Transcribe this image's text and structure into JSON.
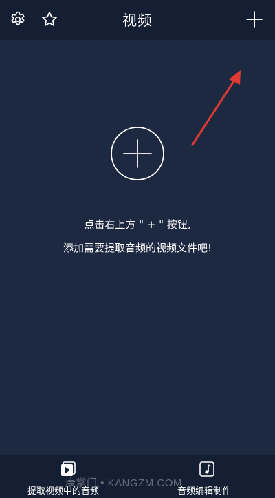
{
  "header": {
    "title": "视频",
    "settings_icon": "gear-icon",
    "favorites_icon": "star-icon",
    "add_icon": "plus-icon"
  },
  "main": {
    "add_icon": "circle-plus-icon",
    "hint_line1": "点击右上方 \" + \" 按钮,",
    "hint_line2": "添加需要提取音频的视频文件吧!",
    "annotation_color": "#e03b32"
  },
  "tabbar": {
    "tabs": [
      {
        "label": "提取视频中的音频",
        "icon": "video-play-icon"
      },
      {
        "label": "音频编辑制作",
        "icon": "music-note-icon"
      }
    ]
  },
  "watermark": "康掌门 • KANGZM.COM",
  "colors": {
    "background": "#1c2941",
    "bars": "#141f33",
    "text": "#ffffff"
  }
}
